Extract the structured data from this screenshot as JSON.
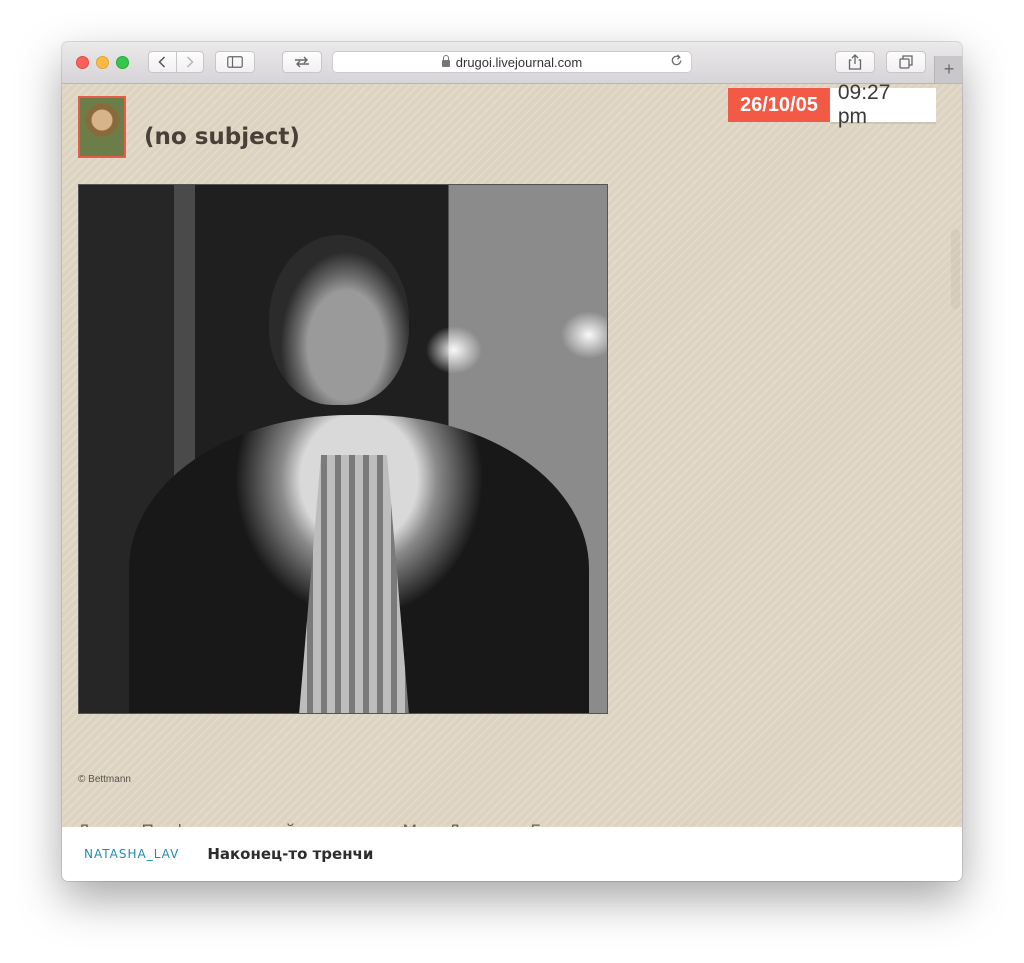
{
  "browser": {
    "url": "drugoi.livejournal.com",
    "new_tab_label": "+"
  },
  "post": {
    "subject": "(no subject)",
    "date": "26/10/05",
    "time": "09:27 pm",
    "photo_credit": "© Bettmann",
    "caption": "Леонид Парфенов похожий на молодого Мика Джаггера. Бывает же такое."
  },
  "bottom_bar": {
    "username": "NATASHA_LAV",
    "title": "Наконец-то тренчи"
  },
  "colors": {
    "date_badge": "#f25a45",
    "page_background": "#ddd3c1",
    "username_link": "#1f8cb3"
  }
}
